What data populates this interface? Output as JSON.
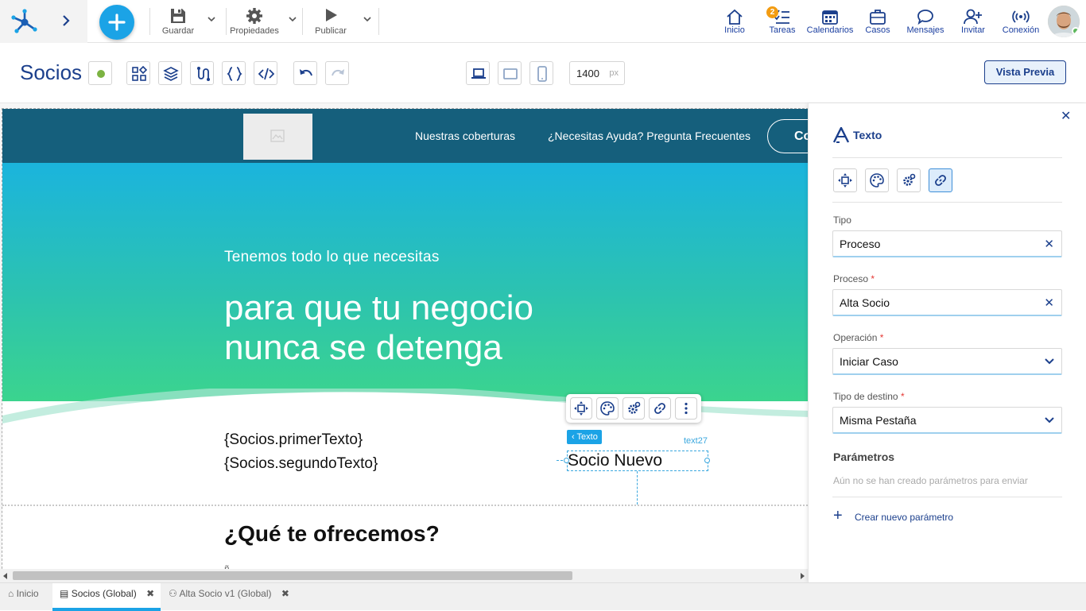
{
  "toolbar": {
    "save": "Guardar",
    "properties": "Propiedades",
    "publish": "Publicar"
  },
  "nav": {
    "items": [
      {
        "label": "Inicio",
        "icon": "home-icon"
      },
      {
        "label": "Tareas",
        "icon": "tasks-icon",
        "badge": "2"
      },
      {
        "label": "Calendarios",
        "icon": "calendar-icon"
      },
      {
        "label": "Casos",
        "icon": "briefcase-icon"
      },
      {
        "label": "Mensajes",
        "icon": "chat-icon"
      },
      {
        "label": "Invitar",
        "icon": "add-user-icon"
      },
      {
        "label": "Conexión",
        "icon": "signal-icon"
      }
    ]
  },
  "editor": {
    "page_name": "Socios",
    "width_value": "1400",
    "width_unit": "px",
    "preview_label": "Vista Previa"
  },
  "site": {
    "nav1": "Nuestras coberturas",
    "nav2": "¿Necesitas Ayuda? Pregunta Frecuentes",
    "contact_btn": "Co",
    "hero_subtitle": "Tenemos todo lo que necesitas",
    "hero_title_line1": "para que tu negocio",
    "hero_title_line2": "nunca se detenga",
    "template_line1": "{Socios.primerTexto}",
    "template_line2": "{Socios.segundoTexto}",
    "section_title": "¿Qué te ofrecemos?",
    "section_text_partial": "ñ"
  },
  "selection": {
    "badge": "Texto",
    "element_id": "text27",
    "text": "Socio Nuevo"
  },
  "panel": {
    "title": "Texto",
    "tipo_label": "Tipo",
    "tipo_value": "Proceso",
    "proceso_label": "Proceso",
    "proceso_value": "Alta Socio",
    "operacion_label": "Operación",
    "operacion_value": "Iniciar Caso",
    "destino_label": "Tipo de destino",
    "destino_value": "Misma Pestaña",
    "required_mark": "*",
    "params_title": "Parámetros",
    "params_empty": "Aún no se han creado parámetros para enviar",
    "new_param": "Crear nuevo parámetro"
  },
  "tabs": [
    {
      "label": "Inicio",
      "icon": "home-icon"
    },
    {
      "label": "Socios (Global)",
      "icon": "page-icon",
      "active": true
    },
    {
      "label": "Alta Socio v1 (Global)",
      "icon": "process-icon"
    }
  ],
  "colors": {
    "accent": "#1ba3e6",
    "brand": "#1b3f8c",
    "site_header": "#155f7c",
    "hero_top": "#1bb4dd",
    "hero_bottom": "#3bd48e"
  }
}
